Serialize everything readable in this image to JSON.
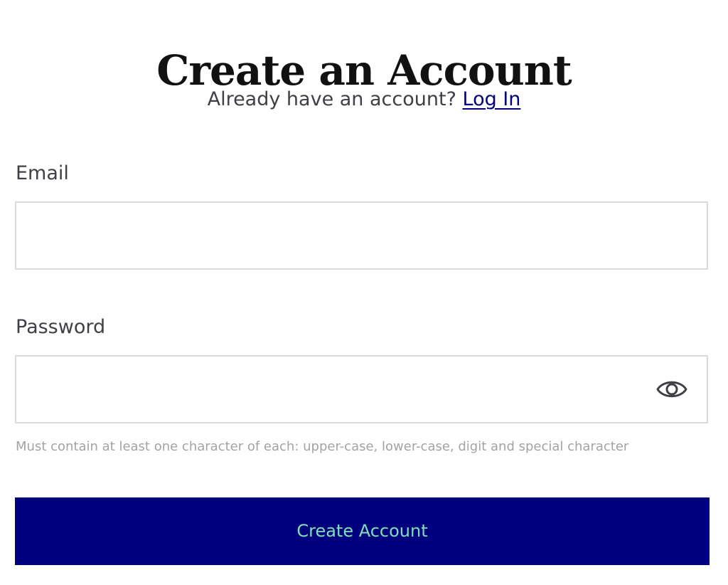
{
  "header": {
    "title": "Create an Account",
    "login_prompt": "Already have an account?",
    "login_link": "Log In"
  },
  "form": {
    "email": {
      "label": "Email",
      "value": "",
      "placeholder": ""
    },
    "password": {
      "label": "Password",
      "value": "",
      "placeholder": "",
      "toggle_icon": "eye-icon",
      "hint": "Must contain at least one character of each: upper-case, lower-case, digit and special character"
    },
    "submit_label": "Create Account"
  },
  "colors": {
    "primary": "#00007f",
    "button_text": "#7ee0b4",
    "link": "#00007f",
    "hint": "#a3a3a3",
    "border": "#dadada"
  }
}
